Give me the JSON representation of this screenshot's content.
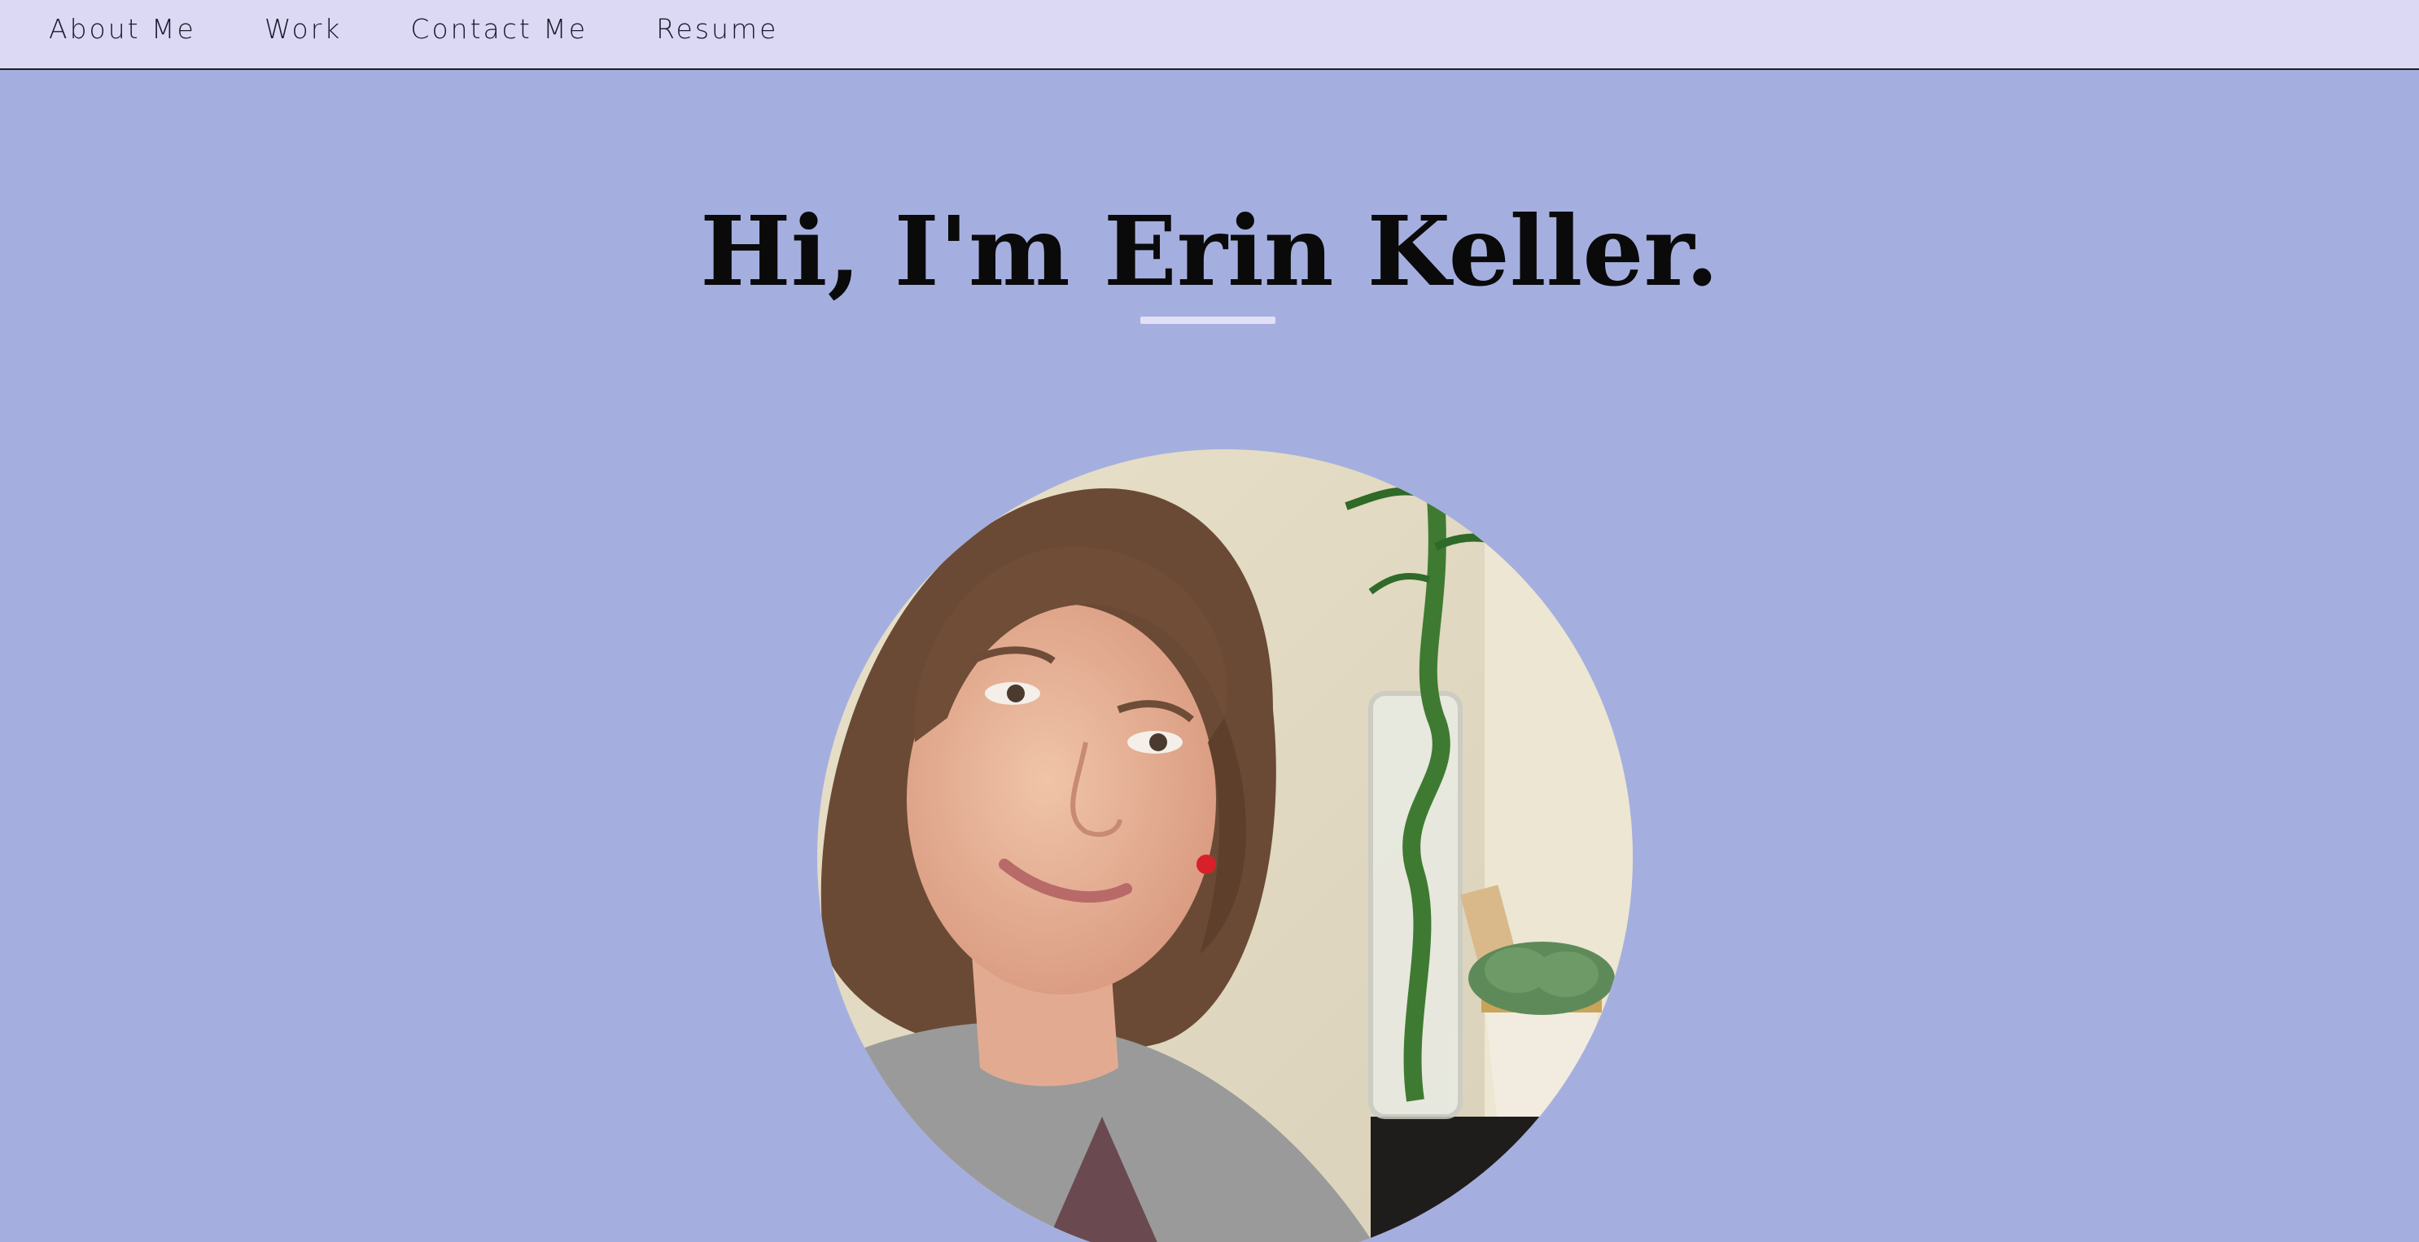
{
  "nav": {
    "items": [
      {
        "label": "About Me"
      },
      {
        "label": "Work"
      },
      {
        "label": "Contact Me"
      },
      {
        "label": "Resume"
      }
    ]
  },
  "hero": {
    "title": "Hi, I'm Erin Keller."
  },
  "portrait": {
    "alt": "Portrait photo of Erin Keller"
  },
  "colors": {
    "page_background": "#a5afdf",
    "navbar_background": "#dcd9f5",
    "underline": "#e2e0f6"
  }
}
